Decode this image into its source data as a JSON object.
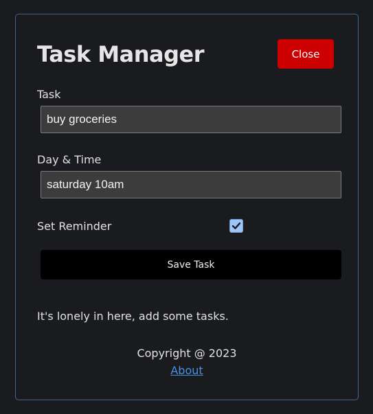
{
  "app": {
    "title": "Task Manager",
    "close_label": "Close"
  },
  "form": {
    "task": {
      "label": "Task",
      "value": "buy groceries"
    },
    "datetime": {
      "label": "Day & Time",
      "value": "saturday 10am"
    },
    "reminder": {
      "label": "Set Reminder",
      "checked": true
    },
    "save_label": "Save Task"
  },
  "tasks": {
    "empty_message": "It's lonely in here, add some tasks."
  },
  "footer": {
    "copyright": "Copyright @ 2023",
    "about_label": "About"
  },
  "colors": {
    "accent_close": "#cc0000",
    "panel_border": "#3e6690",
    "link": "#4a90e2",
    "checkbox": "#9ec5f7"
  },
  "icons": {
    "reminder_check": "checkmark-icon"
  }
}
